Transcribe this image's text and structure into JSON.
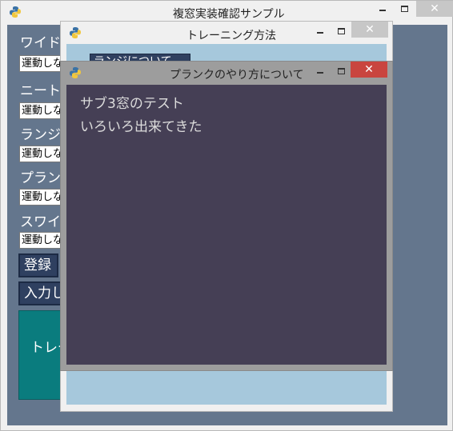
{
  "main_window": {
    "title": "複窓実装確認サンプル",
    "labels": [
      "ワイドプ",
      "ニート",
      "ランジ",
      "プランク",
      "スワイ"
    ],
    "combos": [
      "運動しな",
      "運動しな",
      "運動しな",
      "運動しな",
      "運動しな"
    ],
    "register_button": "登録",
    "input_button": "入力し",
    "teal_button": "トレー"
  },
  "training_window": {
    "title": "トレーニング方法",
    "button_label": "ランジについて"
  },
  "plank_window": {
    "title": "プランクのやり方について",
    "lines": [
      "サブ3窓のテスト",
      "いろいろ出来てきた"
    ]
  },
  "controls": {
    "minimize": "‒",
    "close": "✕"
  },
  "colors": {
    "main_bg": "#64768d",
    "training_bg": "#a6c8dc",
    "plank_bg": "#453f55",
    "button_dark": "#2f4060",
    "teal": "#0a7c7e",
    "close_red": "#c9453f"
  }
}
